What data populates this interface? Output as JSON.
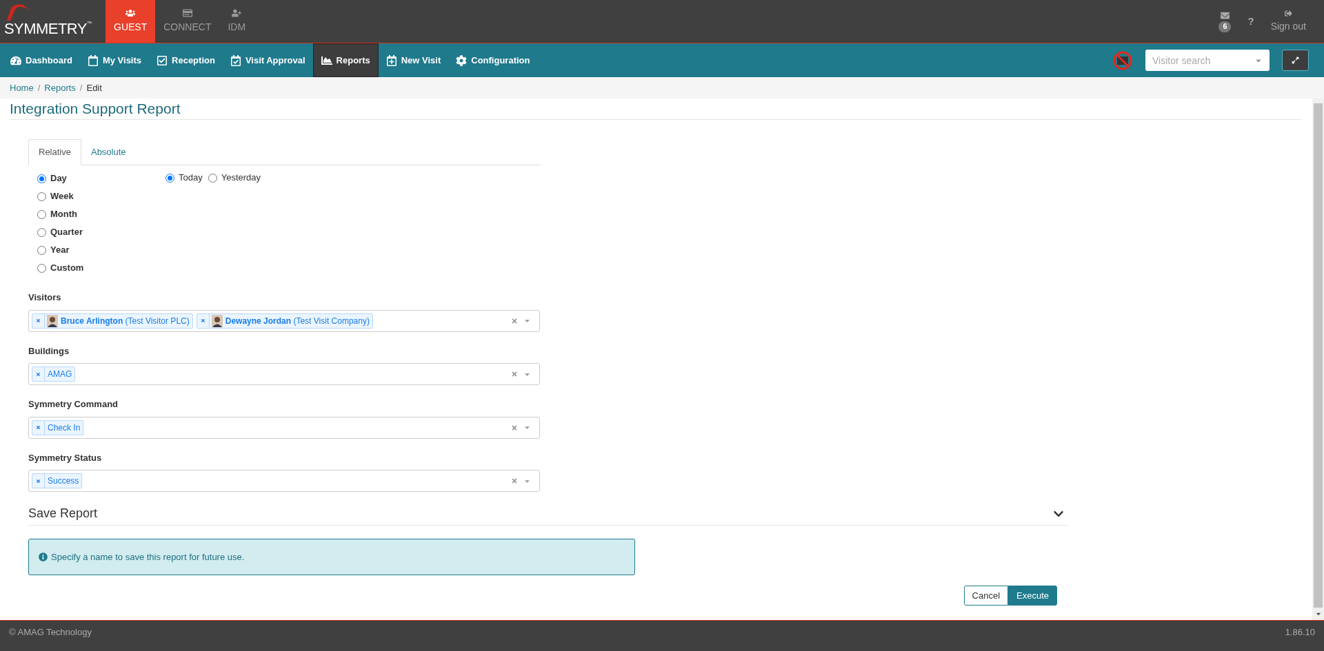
{
  "logo": {
    "text": "SYMMETRY",
    "mark": "™"
  },
  "modules": [
    {
      "label": "GUEST",
      "selected": true,
      "kind": "guest"
    },
    {
      "label": "CONNECT",
      "selected": false,
      "kind": "connect"
    },
    {
      "label": "IDM",
      "selected": false,
      "kind": "idm"
    }
  ],
  "header_actions": {
    "messages_count": "6",
    "help": "?",
    "sign_out": "Sign out"
  },
  "nav": [
    {
      "label": "Dashboard",
      "selected": false,
      "kind": "dashboard"
    },
    {
      "label": "My Visits",
      "selected": false,
      "kind": "visits"
    },
    {
      "label": "Reception",
      "selected": false,
      "kind": "reception"
    },
    {
      "label": "Visit Approval",
      "selected": false,
      "kind": "approval"
    },
    {
      "label": "Reports",
      "selected": true,
      "kind": "reports"
    },
    {
      "label": "New Visit",
      "selected": false,
      "kind": "new"
    },
    {
      "label": "Configuration",
      "selected": false,
      "kind": "config"
    }
  ],
  "visitor_search": {
    "placeholder": "Visitor search"
  },
  "breadcrumb": {
    "separator": "/",
    "items": [
      "Home",
      "Reports",
      "Edit"
    ]
  },
  "title": "Integration Support Report",
  "tabs": [
    {
      "label": "Relative",
      "selected": true
    },
    {
      "label": "Absolute",
      "selected": false
    }
  ],
  "periods": [
    {
      "label": "Day",
      "selected": true
    },
    {
      "label": "Week",
      "selected": false
    },
    {
      "label": "Month",
      "selected": false
    },
    {
      "label": "Quarter",
      "selected": false
    },
    {
      "label": "Year",
      "selected": false
    },
    {
      "label": "Custom",
      "selected": false
    }
  ],
  "day_options": [
    {
      "label": "Today",
      "selected": true
    },
    {
      "label": "Yesterday",
      "selected": false
    }
  ],
  "filters": [
    {
      "label": "Visitors",
      "chips": [
        {
          "kind": "person",
          "name": "Bruce Arlington",
          "detail": "(Test Visitor PLC)"
        },
        {
          "kind": "person",
          "name": "Dewayne Jordan",
          "detail": "(Test Visit Company)"
        }
      ]
    },
    {
      "label": "Buildings",
      "chips": [
        {
          "kind": "plain",
          "name": "AMAG"
        }
      ]
    },
    {
      "label": "Symmetry Command",
      "chips": [
        {
          "kind": "plain",
          "name": "Check In"
        }
      ]
    },
    {
      "label": "Symmetry Status",
      "chips": [
        {
          "kind": "plain",
          "name": "Success"
        }
      ]
    }
  ],
  "save_section": {
    "title": "Save Report",
    "expanded": false,
    "info": "Specify a name to save this report for future use."
  },
  "buttons": [
    {
      "label": "Cancel",
      "kind": "secondary"
    },
    {
      "label": "Execute",
      "kind": "primary"
    }
  ],
  "footer": {
    "copyright": "© AMAG Technology",
    "version": "1.86.10"
  }
}
